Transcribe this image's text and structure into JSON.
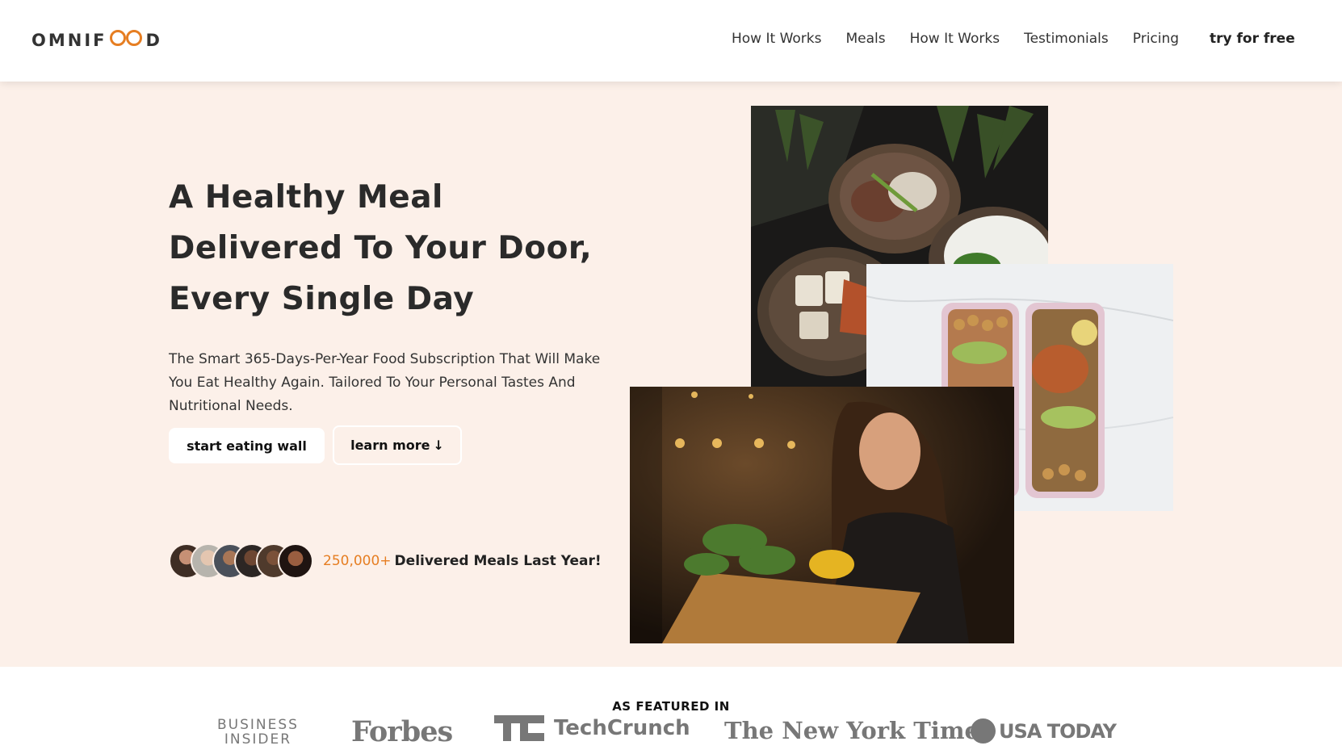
{
  "header": {
    "logo_text_before": "OMNIF",
    "logo_text_after": "D",
    "nav": [
      "How It Works",
      "Meals",
      "How It Works",
      "Testimonials",
      "Pricing"
    ],
    "cta": "try for free"
  },
  "hero": {
    "title": "A Healthy Meal Delivered To Your Door, Every Single Day",
    "description": "The Smart 365-Days-Per-Year Food Subscription That Will Make You Eat Healthy Again. Tailored To Your Personal Tastes And Nutritional Needs.",
    "primary_button": "start eating wall",
    "secondary_button": "learn more",
    "secondary_button_icon": "↓",
    "delivered_count": "250,000+",
    "delivered_label": "Delivered Meals Last Year!"
  },
  "featured": {
    "title": "AS FEATURED IN",
    "logos": {
      "business_insider_line1": "BUSINESS",
      "business_insider_line2": "INSIDER",
      "forbes": "Forbes",
      "techcrunch": "TechCrunch",
      "nyt": "The New York Times",
      "usa_today": "USA TODAY"
    }
  },
  "colors": {
    "accent": "#e67e22",
    "hero_bg": "#fcf0e9",
    "text": "#333333"
  }
}
